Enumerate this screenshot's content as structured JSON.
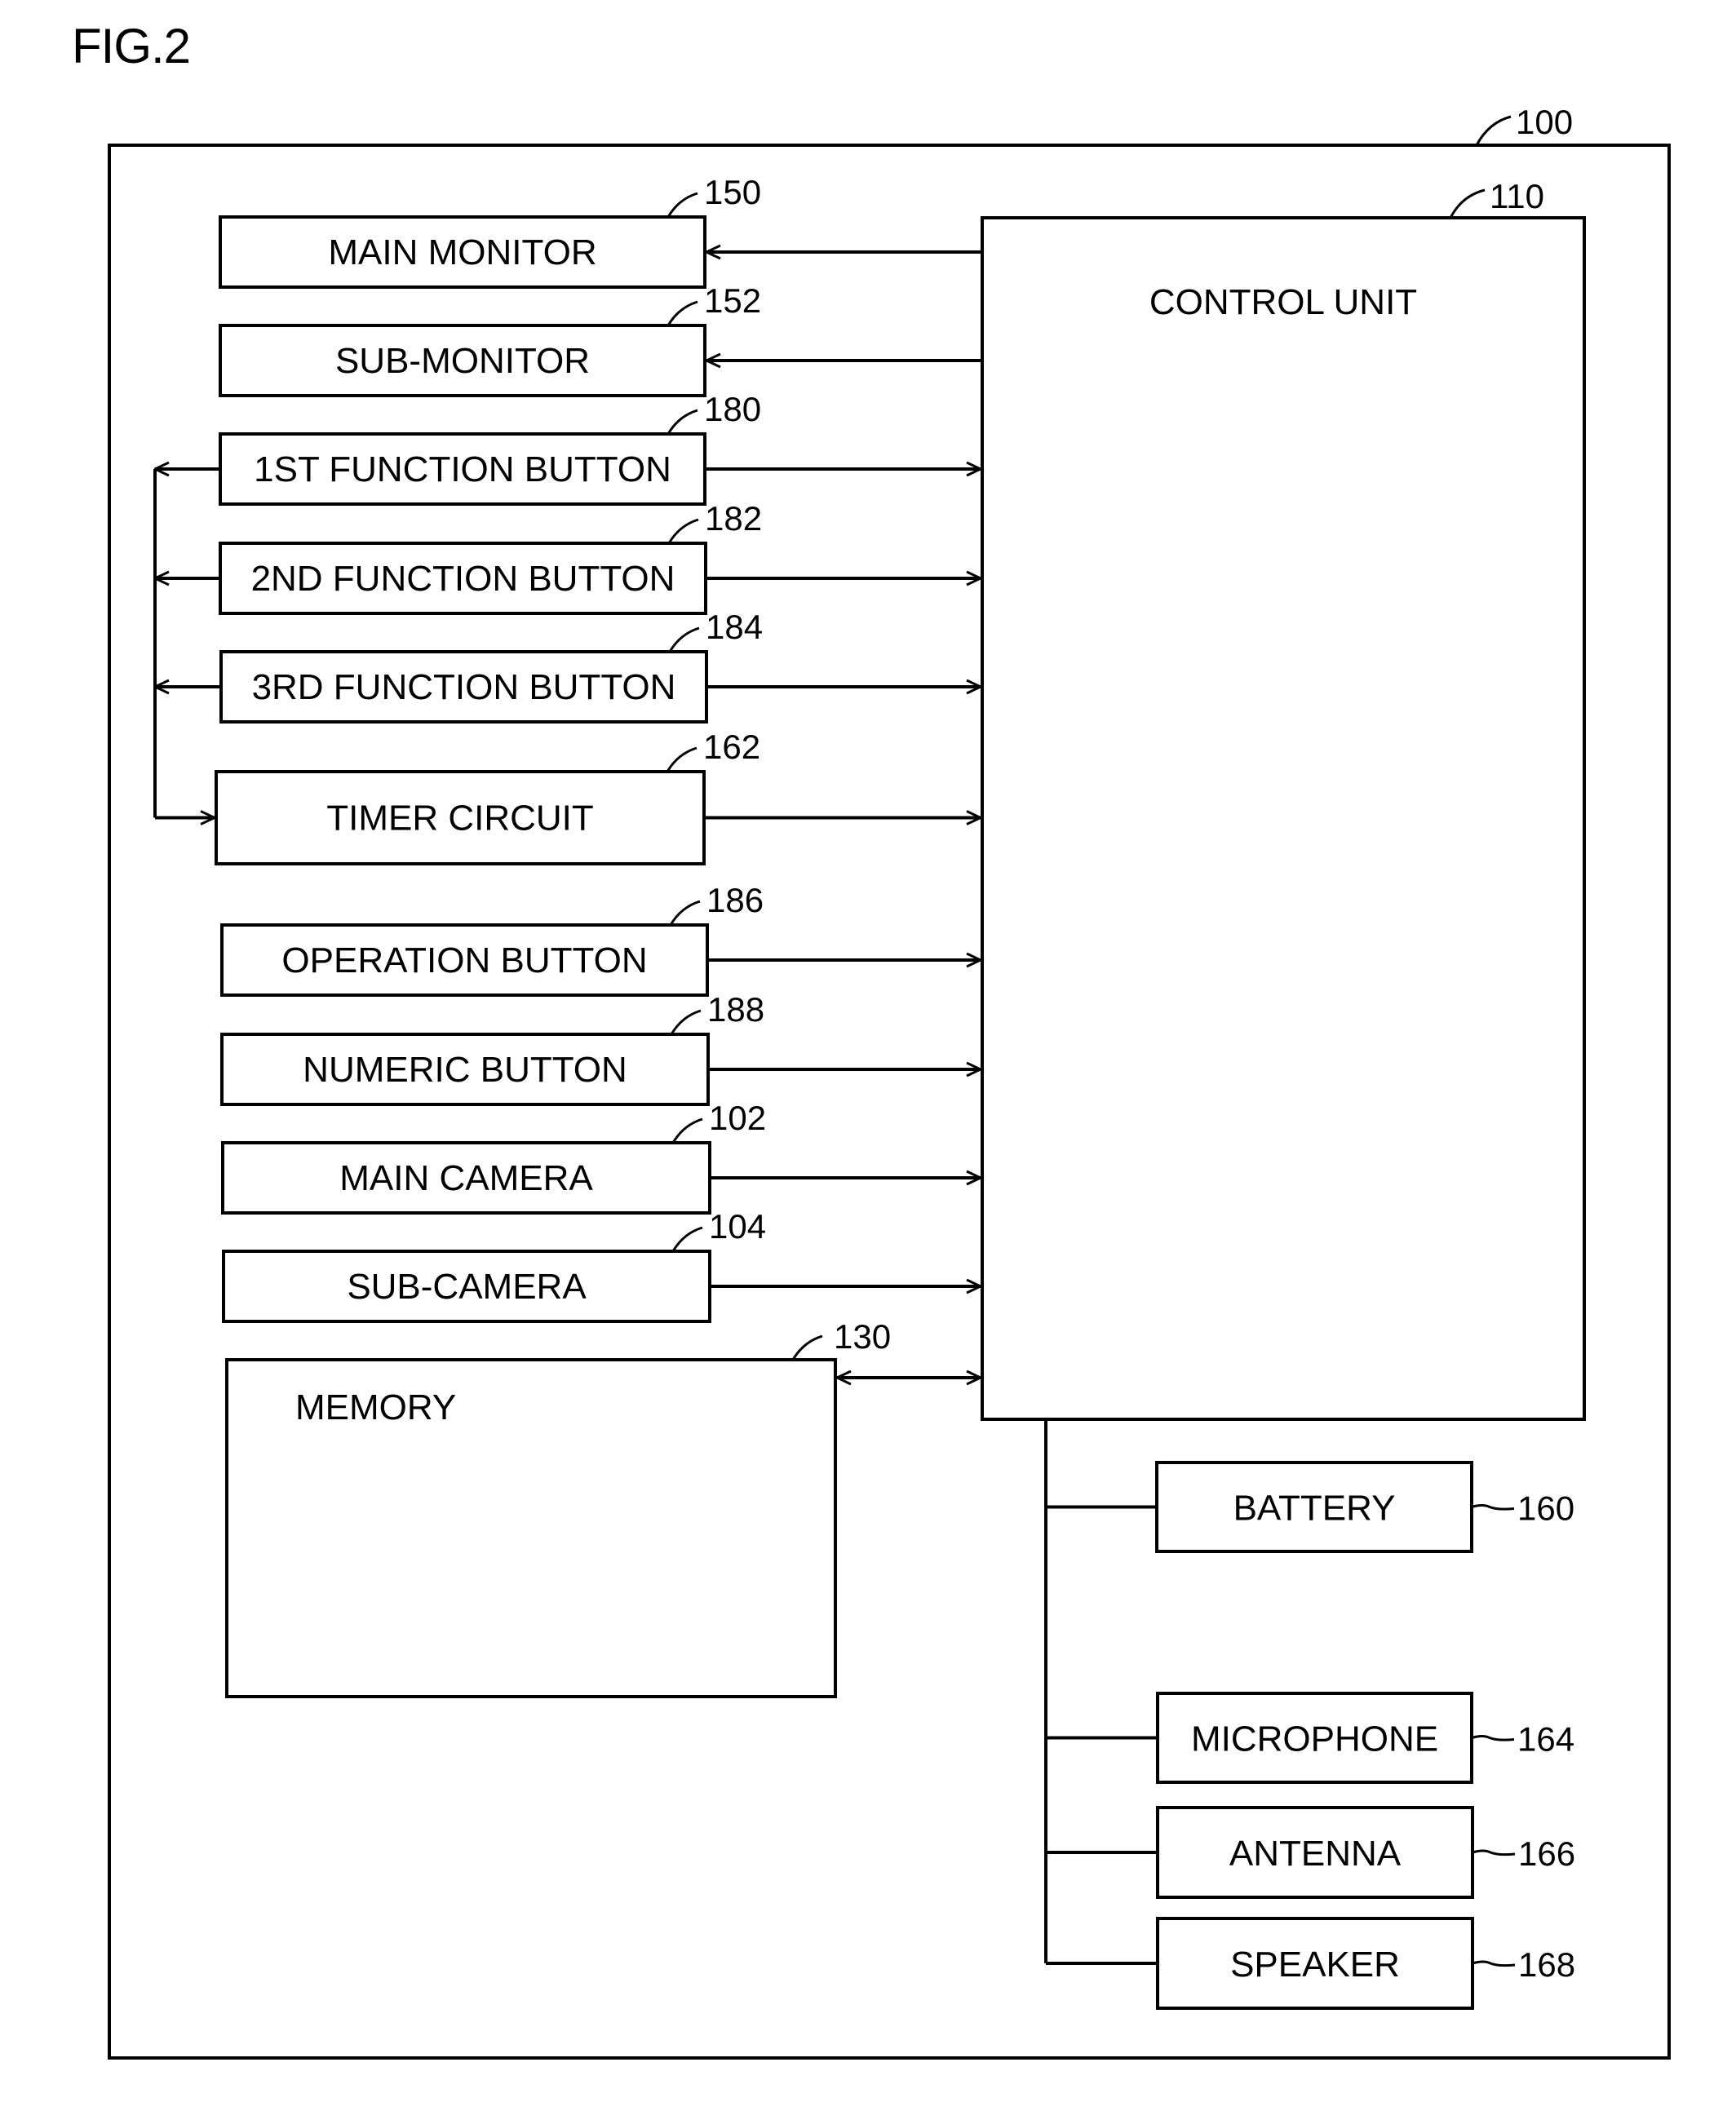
{
  "figure": {
    "title": "FIG.2",
    "device_ref": "100",
    "line_color": "#000000",
    "background": "#ffffff"
  },
  "control_unit": {
    "label": "CONTROL UNIT",
    "ref": "110"
  },
  "left_blocks": [
    {
      "id": "main-monitor",
      "label": "MAIN MONITOR",
      "ref": "150",
      "direction": "from-control"
    },
    {
      "id": "sub-monitor",
      "label": "SUB-MONITOR",
      "ref": "152",
      "direction": "from-control"
    },
    {
      "id": "first-function-button",
      "label": "1ST FUNCTION BUTTON",
      "ref": "180",
      "direction": "to-control",
      "feeds_timer": true
    },
    {
      "id": "second-function-button",
      "label": "2ND FUNCTION BUTTON",
      "ref": "182",
      "direction": "to-control",
      "feeds_timer": true
    },
    {
      "id": "third-function-button",
      "label": "3RD FUNCTION BUTTON",
      "ref": "184",
      "direction": "to-control",
      "feeds_timer": true
    },
    {
      "id": "timer-circuit",
      "label": "TIMER CIRCUIT",
      "ref": "162",
      "direction": "to-control"
    },
    {
      "id": "operation-button",
      "label": "OPERATION BUTTON",
      "ref": "186",
      "direction": "to-control"
    },
    {
      "id": "numeric-button",
      "label": "NUMERIC BUTTON",
      "ref": "188",
      "direction": "to-control"
    },
    {
      "id": "main-camera",
      "label": "MAIN CAMERA",
      "ref": "102",
      "direction": "to-control"
    },
    {
      "id": "sub-camera",
      "label": "SUB-CAMERA",
      "ref": "104",
      "direction": "to-control"
    }
  ],
  "memory": {
    "label": "MEMORY",
    "ref": "130",
    "direction": "bidirectional"
  },
  "bus_blocks": [
    {
      "id": "battery",
      "label": "BATTERY",
      "ref": "160"
    },
    {
      "id": "microphone",
      "label": "MICROPHONE",
      "ref": "164"
    },
    {
      "id": "antenna",
      "label": "ANTENNA",
      "ref": "166"
    },
    {
      "id": "speaker",
      "label": "SPEAKER",
      "ref": "168"
    }
  ]
}
